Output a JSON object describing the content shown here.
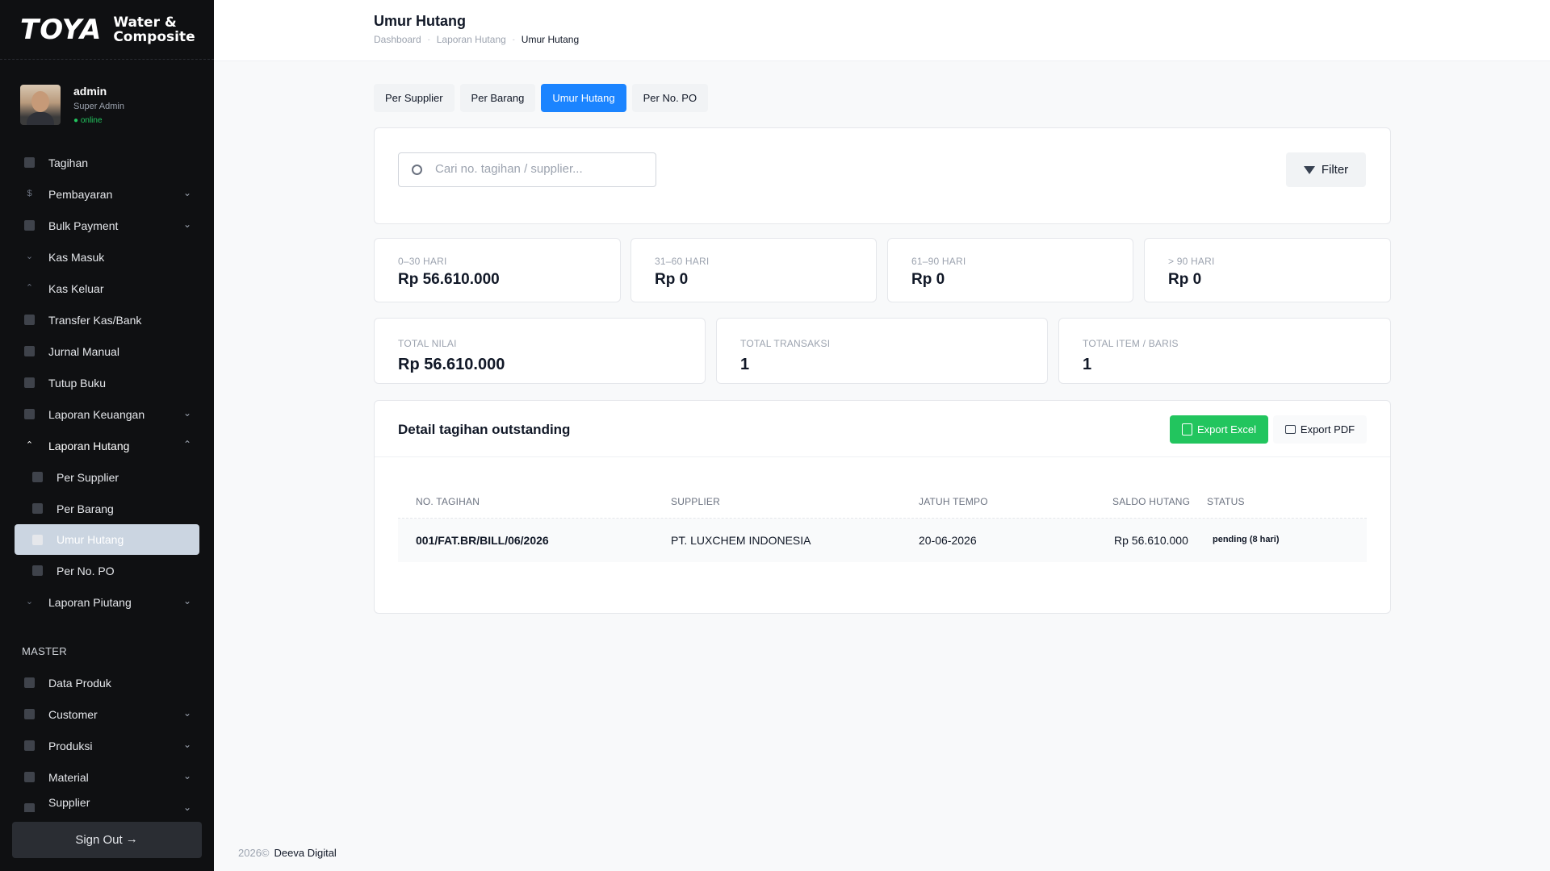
{
  "brand": {
    "logo": "TOYA",
    "sub_line1": "Water &",
    "sub_line2": "Composite"
  },
  "profile": {
    "name": "admin",
    "role": "Super Admin",
    "status": "● online"
  },
  "sidebar": {
    "items": [
      {
        "label": "Tagihan"
      },
      {
        "label": "Pembayaran"
      },
      {
        "label": "Bulk Payment"
      },
      {
        "label": "Kas Masuk"
      },
      {
        "label": "Kas Keluar"
      },
      {
        "label": "Transfer Kas/Bank"
      },
      {
        "label": "Jurnal Manual"
      },
      {
        "label": "Tutup Buku"
      },
      {
        "label": "Laporan Keuangan"
      },
      {
        "label": "Laporan Hutang"
      },
      {
        "label": "Per Supplier"
      },
      {
        "label": "Per Barang"
      },
      {
        "label": "Umur Hutang"
      },
      {
        "label": "Per No. PO"
      },
      {
        "label": "Laporan Piutang"
      }
    ],
    "section_master": "MASTER",
    "master_items": [
      {
        "label": "Data Produk"
      },
      {
        "label": "Customer"
      },
      {
        "label": "Produksi"
      },
      {
        "label": "Material"
      },
      {
        "label": "Supplier"
      }
    ],
    "signout": "Sign Out"
  },
  "header": {
    "title": "Umur Hutang",
    "breadcrumb": [
      "Dashboard",
      "Laporan Hutang",
      "Umur Hutang"
    ]
  },
  "tabs": [
    "Per Supplier",
    "Per Barang",
    "Umur Hutang",
    "Per No. PO"
  ],
  "search": {
    "placeholder": "Cari no. tagihan / supplier...",
    "filter_label": "Filter"
  },
  "aging": [
    {
      "label": "0–30 HARI",
      "value": "Rp 56.610.000"
    },
    {
      "label": "31–60 HARI",
      "value": "Rp 0"
    },
    {
      "label": "61–90 HARI",
      "value": "Rp 0"
    },
    {
      "label": "> 90 HARI",
      "value": "Rp 0"
    }
  ],
  "totals": [
    {
      "label": "TOTAL NILAI",
      "value": "Rp 56.610.000"
    },
    {
      "label": "TOTAL TRANSAKSI",
      "value": "1"
    },
    {
      "label": "TOTAL ITEM / BARIS",
      "value": "1"
    }
  ],
  "detail": {
    "title": "Detail tagihan outstanding",
    "export_excel": "Export Excel",
    "export_pdf": "Export PDF",
    "columns": [
      "NO. TAGIHAN",
      "SUPPLIER",
      "JATUH TEMPO",
      "SALDO HUTANG",
      "STATUS"
    ],
    "rows": [
      {
        "no": "001/FAT.BR/BILL/06/2026",
        "supplier": "PT. LUXCHEM INDONESIA",
        "due": "20-06-2026",
        "saldo": "Rp 56.610.000",
        "status": "pending (8 hari)"
      }
    ]
  },
  "footer": {
    "year": "2026©",
    "company": "Deeva Digital"
  }
}
